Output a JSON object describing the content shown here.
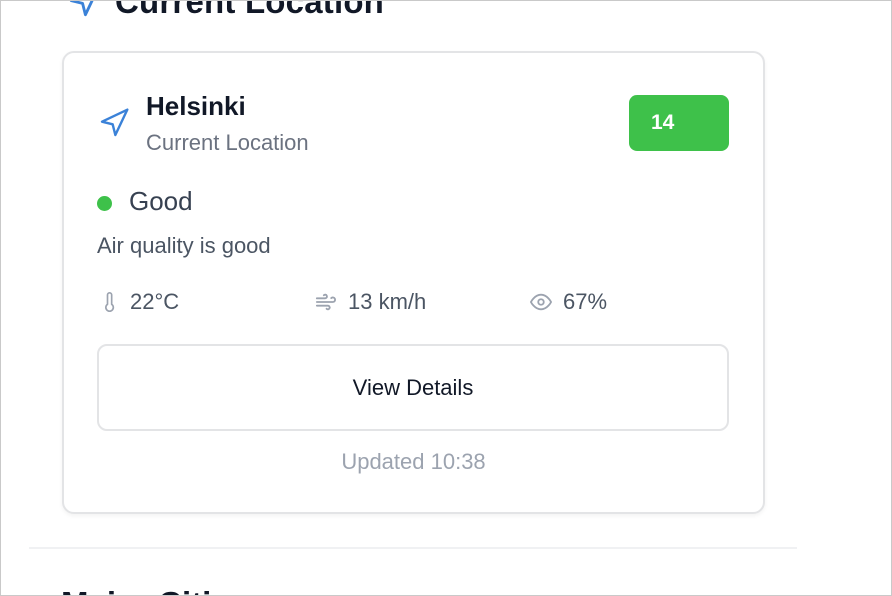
{
  "section": {
    "title": "Current Location",
    "icon": "navigation-arrow-icon"
  },
  "card": {
    "city": "Helsinki",
    "subtitle": "Current Location",
    "aqi": "14",
    "status": "Good",
    "status_color": "#3ec14a",
    "description": "Air quality is good",
    "metrics": {
      "temperature": "22°C",
      "wind": "13 km/h",
      "humidity": "67%"
    },
    "button_label": "View Details",
    "updated": "Updated 10:38"
  },
  "next_section": {
    "title": "Major Cities"
  },
  "colors": {
    "accent": "#3b82d8",
    "good": "#3ec14a",
    "text_primary": "#111827",
    "text_muted": "#6b7280"
  }
}
